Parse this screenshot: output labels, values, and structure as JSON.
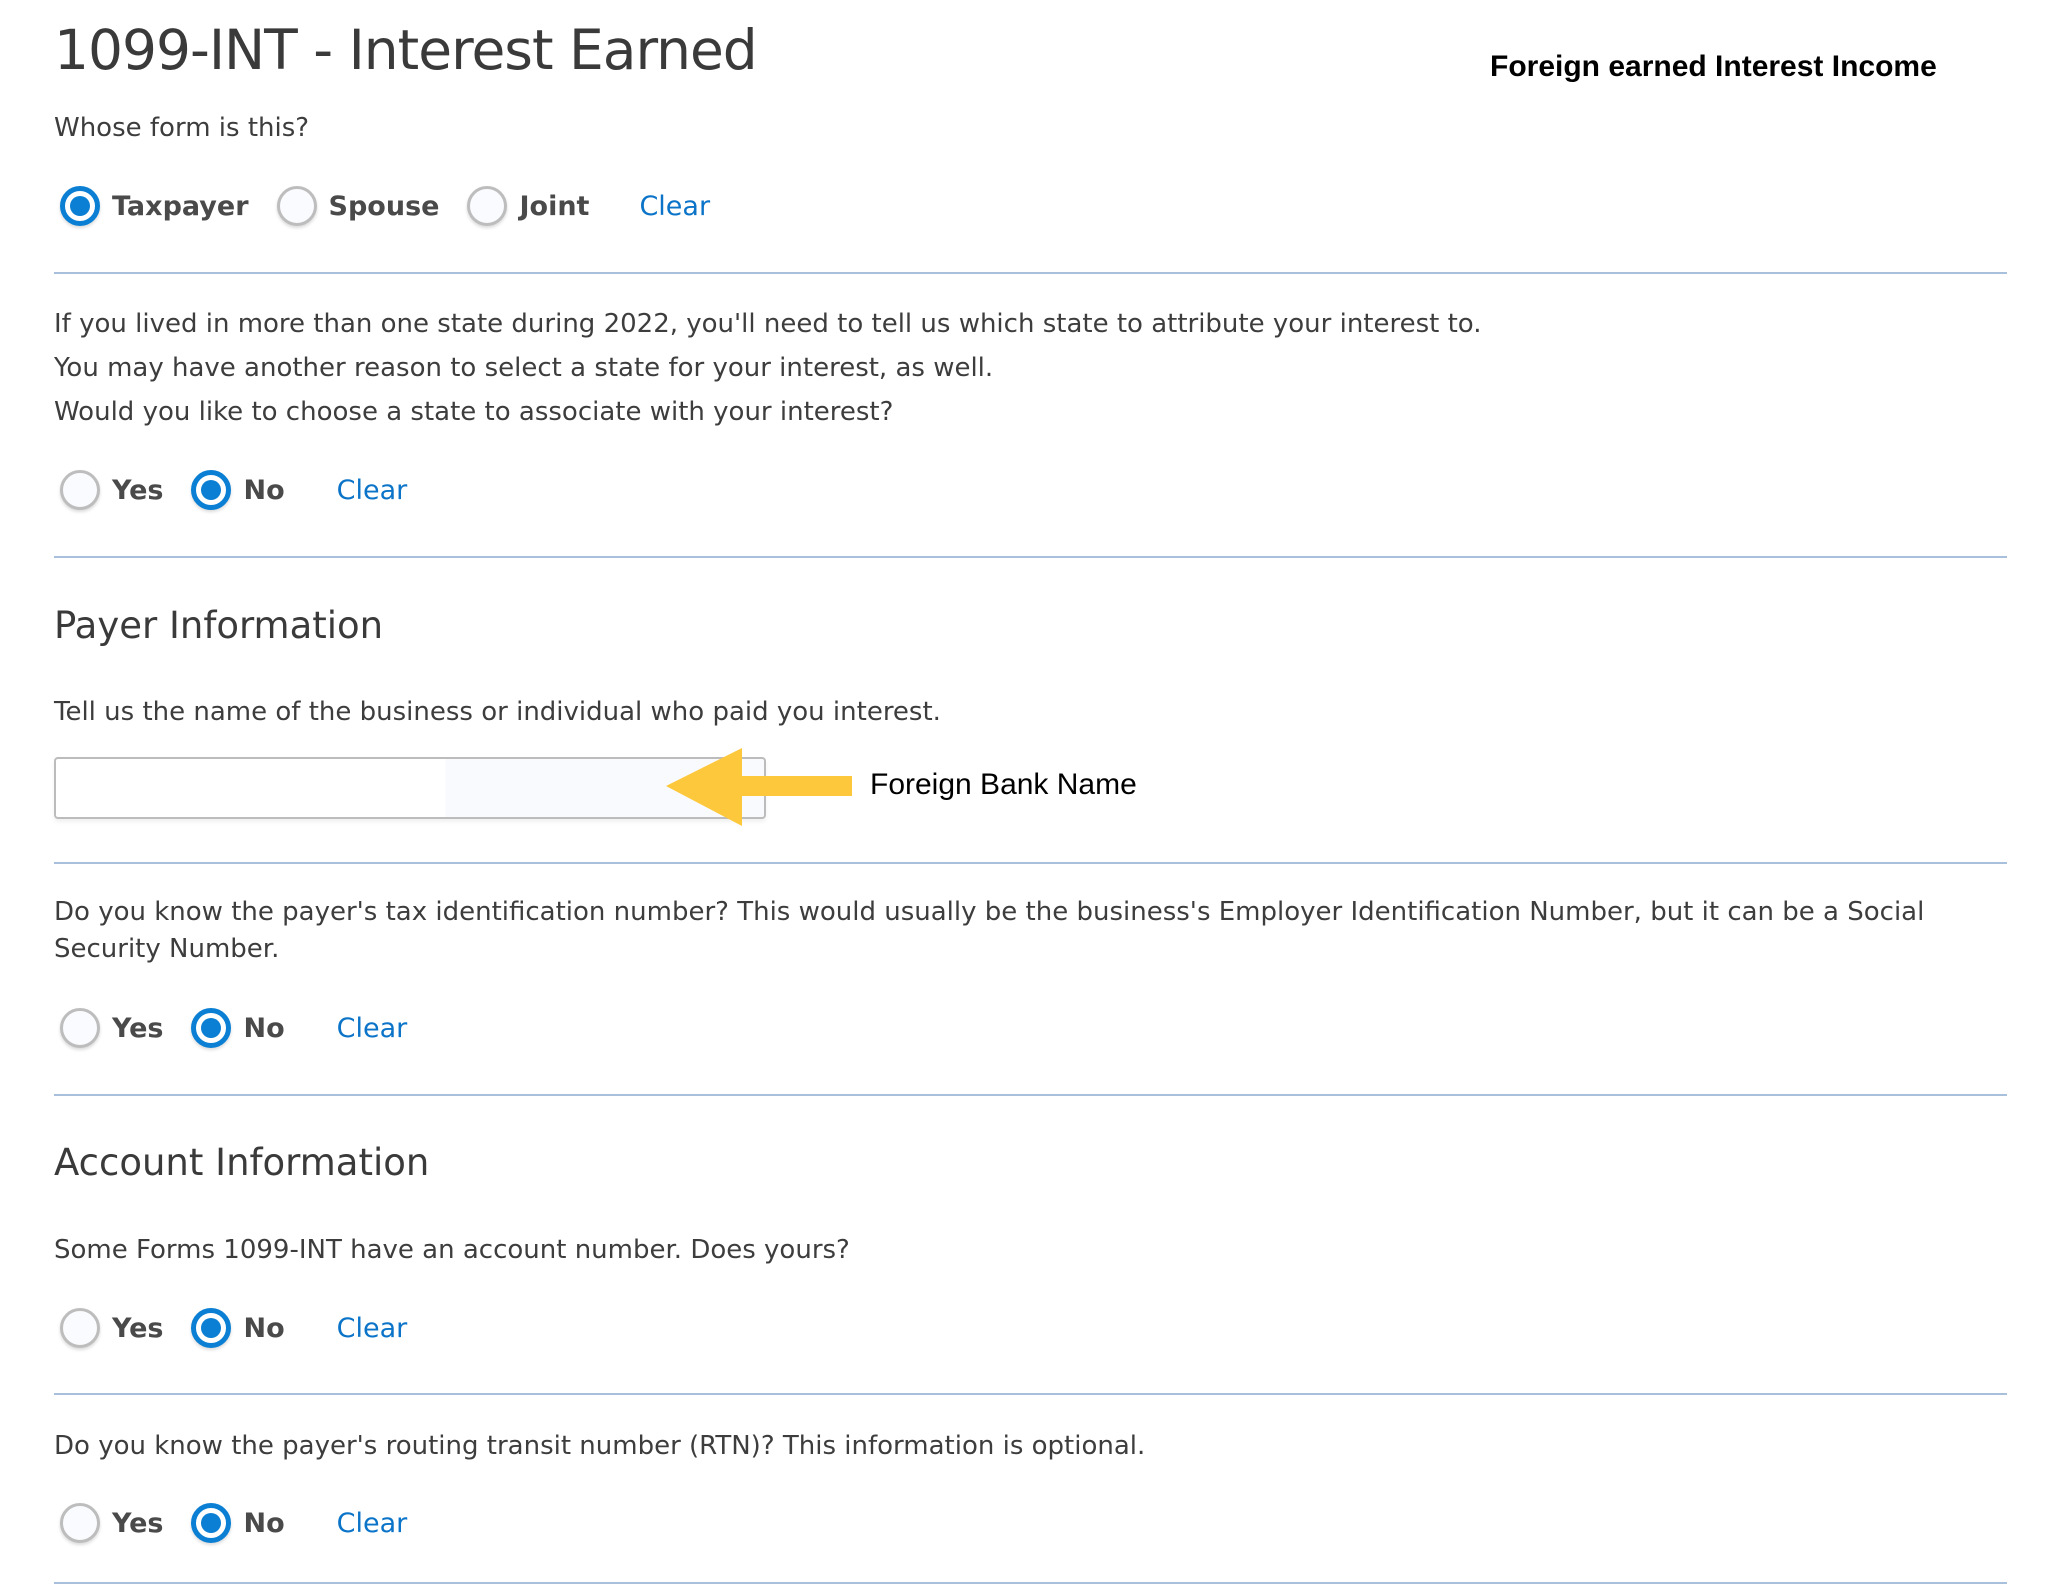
{
  "page": {
    "title": "1099-INT - Interest Earned",
    "annotation_top": "Foreign earned Interest Income",
    "annotation_input": "Foreign Bank Name"
  },
  "colors": {
    "accent": "#0b7fd3",
    "link": "#0b74c8",
    "divider": "#a9c0dd",
    "annotation_arrow": "#fdc83c"
  },
  "whose_form": {
    "question": "Whose form is this?",
    "options": [
      {
        "label": "Taxpayer",
        "checked": true
      },
      {
        "label": "Spouse",
        "checked": false
      },
      {
        "label": "Joint",
        "checked": false
      }
    ],
    "clear_label": "Clear"
  },
  "state": {
    "lines": [
      "If you lived in more than one state during 2022, you'll need to tell us which state to attribute your interest to.",
      "You may have another reason to select a state for your interest, as well.",
      "Would you like to choose a state to associate with your interest?"
    ],
    "options": [
      {
        "label": "Yes",
        "checked": false
      },
      {
        "label": "No",
        "checked": true
      }
    ],
    "clear_label": "Clear"
  },
  "payer": {
    "section_title": "Payer Information",
    "prompt": "Tell us the name of the business or individual who paid you interest.",
    "name_value": "",
    "tin_question": "Do you know the payer's tax identification number? This would usually be the business's Employer Identification Number, but it can be a Social Security Number.",
    "tin_options": [
      {
        "label": "Yes",
        "checked": false
      },
      {
        "label": "No",
        "checked": true
      }
    ],
    "clear_label": "Clear"
  },
  "account": {
    "section_title": "Account Information",
    "account_question": "Some Forms 1099-INT have an account number. Does yours?",
    "account_options": [
      {
        "label": "Yes",
        "checked": false
      },
      {
        "label": "No",
        "checked": true
      }
    ],
    "rtn_question": "Do you know the payer's routing transit number (RTN)? This information is optional.",
    "rtn_options": [
      {
        "label": "Yes",
        "checked": false
      },
      {
        "label": "No",
        "checked": true
      }
    ],
    "clear_label": "Clear"
  }
}
